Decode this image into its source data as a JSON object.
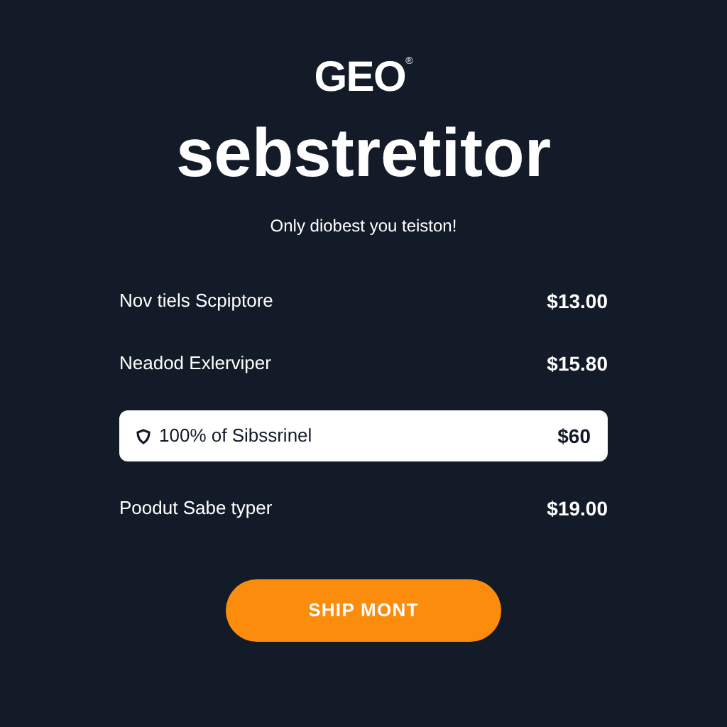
{
  "logo": {
    "text": "GEO",
    "mark": "®"
  },
  "title": "sebstretitor",
  "subtitle": "Only diobest you teiston!",
  "options": [
    {
      "label": "Nov tiels Scpiptore",
      "price": "$13.00",
      "selected": false
    },
    {
      "label": "Neadod Exlerviper",
      "price": "$15.80",
      "selected": false
    },
    {
      "label": "100% of Sibssrinel",
      "price": "$60",
      "selected": true
    },
    {
      "label": "Poodut Sabe typer",
      "price": "$19.00",
      "selected": false
    }
  ],
  "button": "SHIP MONT"
}
